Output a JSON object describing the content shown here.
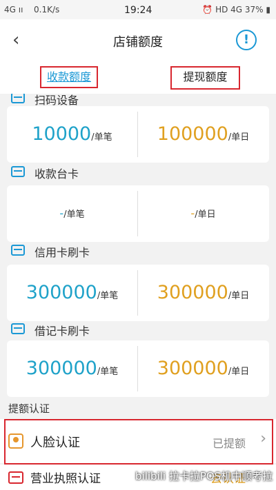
{
  "status_bar": {
    "signal": "4G ıı",
    "speed": "0.1K/s",
    "time": "19:24",
    "right": "⏰ HD 4G 37% ▮"
  },
  "nav": {
    "back_icon": "‹",
    "title": "店铺额度",
    "info_icon": "!"
  },
  "tabs": [
    {
      "label": "收款额度",
      "selected": true
    },
    {
      "label": "提现额度",
      "selected": false
    }
  ],
  "sections": [
    {
      "label": "扫码设备",
      "per_txn": "10000",
      "per_txn_unit": "/单笔",
      "per_day": "100000",
      "per_day_unit": "/单日"
    },
    {
      "label": "收款台卡",
      "per_txn": "-",
      "per_txn_unit": "/单笔",
      "per_day": "-",
      "per_day_unit": "/单日"
    },
    {
      "label": "信用卡刷卡",
      "per_txn": "300000",
      "per_txn_unit": "/单笔",
      "per_day": "300000",
      "per_day_unit": "/单日"
    },
    {
      "label": "借记卡刷卡",
      "per_txn": "300000",
      "per_txn_unit": "/单笔",
      "per_day": "300000",
      "per_day_unit": "/单日"
    }
  ],
  "auth": {
    "title": "提额认证",
    "items": [
      {
        "label": "人脸认证",
        "status": "已提额"
      },
      {
        "label": "营业执照认证",
        "status": "去认证"
      }
    ]
  },
  "watermark": "bilibili 拉卡拉POS机中顺考拉",
  "colors": {
    "accent_blue": "#1a98d5",
    "value_blue": "#1fa2c9",
    "value_orange": "#e0a020",
    "highlight_red": "#d8262e"
  }
}
